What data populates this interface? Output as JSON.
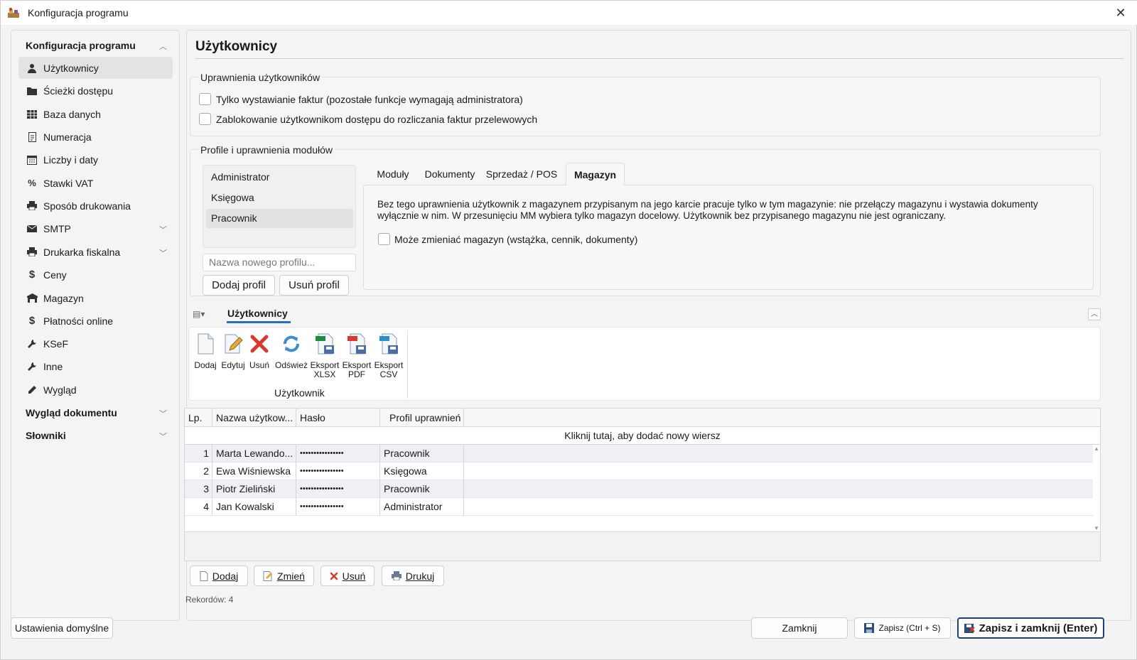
{
  "window": {
    "title": "Konfiguracja programu"
  },
  "sidebar": {
    "group_config": "Konfiguracja programu",
    "items": [
      {
        "label": "Użytkownicy",
        "icon": "user-icon"
      },
      {
        "label": "Ścieżki dostępu",
        "icon": "folder-icon"
      },
      {
        "label": "Baza danych",
        "icon": "table-icon"
      },
      {
        "label": "Numeracja",
        "icon": "document-icon"
      },
      {
        "label": "Liczby i daty",
        "icon": "calendar-icon"
      },
      {
        "label": "Stawki VAT",
        "icon": "percent-icon"
      },
      {
        "label": "Sposób drukowania",
        "icon": "printer-icon"
      },
      {
        "label": "SMTP",
        "icon": "mail-icon"
      },
      {
        "label": "Drukarka fiskalna",
        "icon": "printer-icon"
      },
      {
        "label": "Ceny",
        "icon": "dollar-icon"
      },
      {
        "label": "Magazyn",
        "icon": "warehouse-icon"
      },
      {
        "label": "Płatności online",
        "icon": "dollar-icon"
      },
      {
        "label": "KSeF",
        "icon": "wrench-icon"
      },
      {
        "label": "Inne",
        "icon": "wrench-icon"
      },
      {
        "label": "Wygląd",
        "icon": "pen-icon"
      }
    ],
    "group_doc": "Wygląd dokumentu",
    "group_dict": "Słowniki"
  },
  "main": {
    "title": "Użytkownicy",
    "permissions": {
      "title": "Uprawnienia użytkowników",
      "opt1": "Tylko wystawianie faktur (pozostałe funkcje wymagają administratora)",
      "opt2": "Zablokowanie użytkownikom dostępu do rozliczania faktur przelewowych"
    },
    "profiles": {
      "title": "Profile i uprawnienia modułów",
      "list": [
        "Administrator",
        "Księgowa",
        "Pracownik"
      ],
      "new_placeholder": "Nazwa nowego profilu...",
      "add_btn": "Dodaj profil",
      "remove_btn": "Usuń profil",
      "tabs": [
        "Moduły",
        "Dokumenty",
        "Sprzedaż / POS",
        "Magazyn"
      ],
      "desc": "Bez tego uprawnienia użytkownik z magazynem przypisanym na jego karcie pracuje tylko w tym magazynie: nie przełączy magazynu i wystawia dokumenty wyłącznie w nim. W przesunięciu MM wybiera tylko magazyn docelowy. Użytkownik bez przypisanego magazynu nie jest ograniczany.",
      "warehouse_opt": "Może zmieniać magazyn (wstążka, cennik, dokumenty)"
    },
    "ribbon": {
      "tab": "Użytkownicy",
      "buttons": [
        {
          "label": "Dodaj",
          "icon": "new-document-icon"
        },
        {
          "label": "Edytuj",
          "icon": "edit-icon"
        },
        {
          "label": "Usuń",
          "icon": "delete-icon"
        },
        {
          "label": "Odśwież",
          "icon": "refresh-icon"
        },
        {
          "label": "Eksport XLSX",
          "icon": "xlsx-export-icon"
        },
        {
          "label": "Eksport PDF",
          "icon": "pdf-export-icon"
        },
        {
          "label": "Eksport CSV",
          "icon": "csv-export-icon"
        }
      ],
      "group_label": "Użytkownik"
    },
    "grid": {
      "headers": [
        "Lp.",
        "Nazwa użytkow...",
        "Hasło",
        "Profil uprawnień"
      ],
      "add_row": "Kliknij tutaj, aby dodać nowy wiersz",
      "rows": [
        {
          "lp": "1",
          "name": "Marta Lewando...",
          "password": "••••••••••••••••",
          "profile": "Pracownik"
        },
        {
          "lp": "2",
          "name": "Ewa Wiśniewska",
          "password": "••••••••••••••••",
          "profile": "Księgowa"
        },
        {
          "lp": "3",
          "name": "Piotr Zieliński",
          "password": "••••••••••••••••",
          "profile": "Pracownik"
        },
        {
          "lp": "4",
          "name": "Jan Kowalski",
          "password": "••••••••••••••••",
          "profile": "Administrator"
        }
      ]
    },
    "bottom_buttons": {
      "add": "Dodaj",
      "change": "Zmień",
      "delete": "Usuń",
      "print": "Drukuj"
    },
    "records": "Rekordów: 4"
  },
  "footer": {
    "defaults": "Ustawienia domyślne",
    "close": "Zamknij",
    "save": "Zapisz (Ctrl + S)",
    "save_close": "Zapisz i zamknij (Enter)"
  }
}
